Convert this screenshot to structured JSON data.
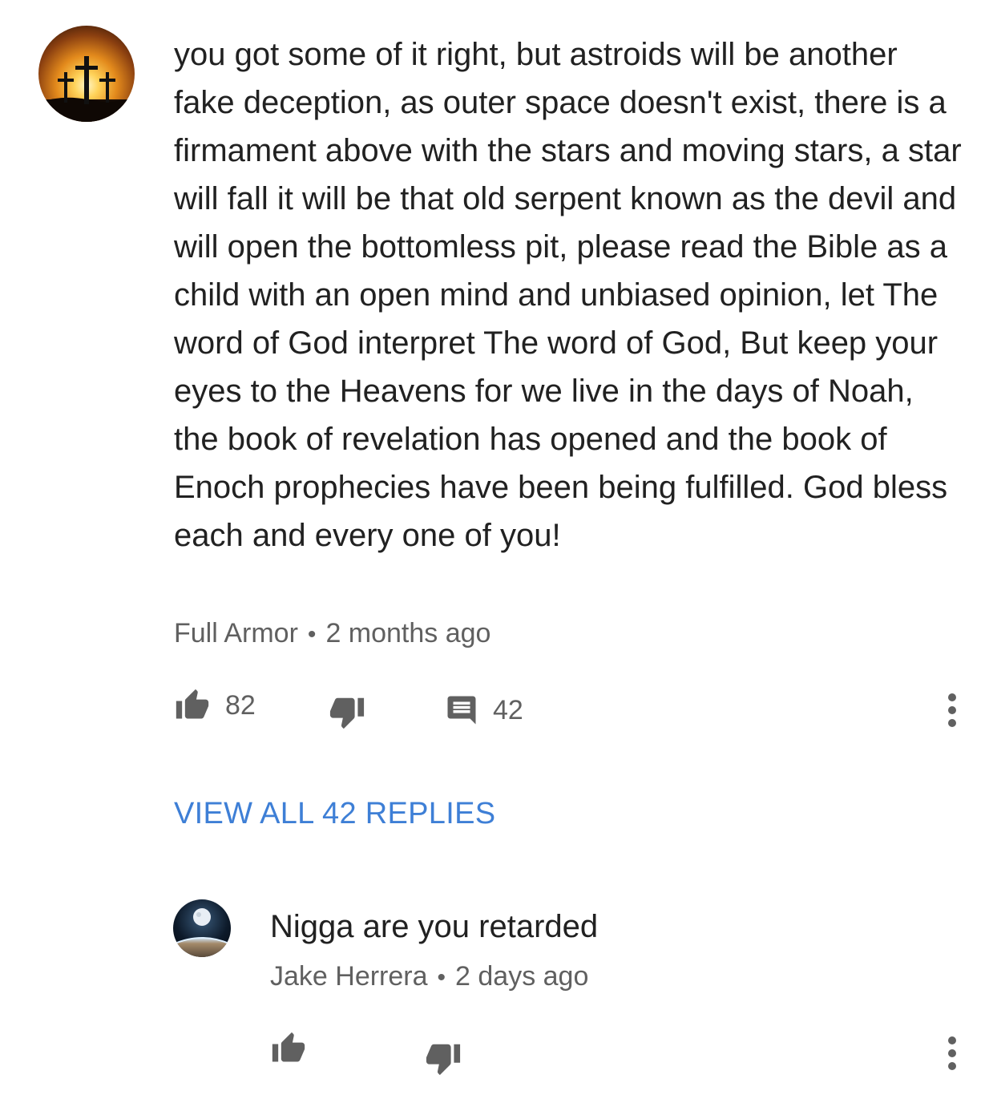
{
  "comment": {
    "text": "you got some of it right, but astroids will be another fake deception, as outer space doesn't exist, there is a firmament above with the stars and moving stars, a star will fall it will be that old serpent known as the devil and will open the bottomless pit, please read the Bible as a child with an open mind and unbiased opinion, let The word of God interpret The word of God, But keep your eyes to the Heavens for we live in the days of Noah, the book of revelation has opened and the book of Enoch prophecies have been being fulfilled. God bless each and every one of you!",
    "author": "Full Armor",
    "separator": "•",
    "time": "2 months ago",
    "likes": "82",
    "replies_count": "42",
    "avatar_icon": "crosses-sunset-avatar"
  },
  "view_replies": {
    "label": "VIEW ALL 42 REPLIES"
  },
  "reply": {
    "text": "Nigga are you retarded",
    "author": "Jake Herrera",
    "separator": "•",
    "time": "2 days ago",
    "avatar_icon": "earth-moon-avatar"
  },
  "colors": {
    "text": "#212121",
    "meta": "#606060",
    "link": "#3e7fd6",
    "background": "#ffffff"
  }
}
